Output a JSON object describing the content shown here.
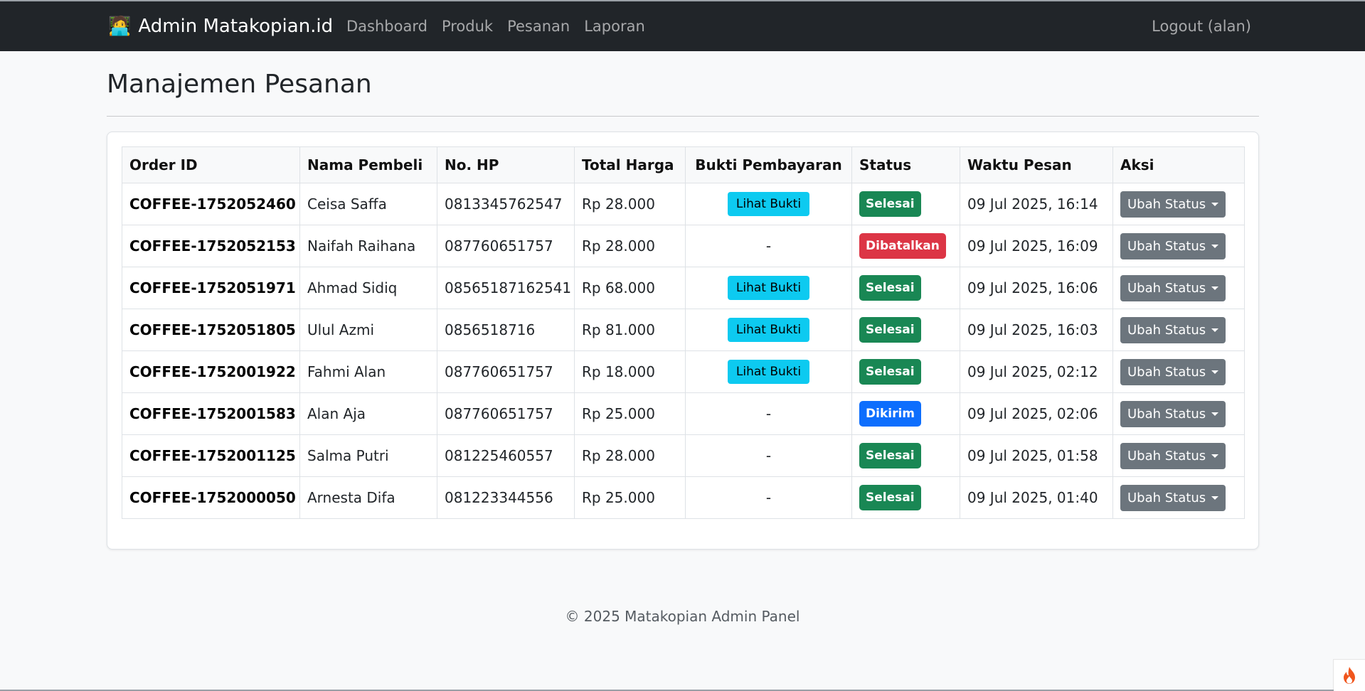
{
  "navbar": {
    "brand_icon": "🧑‍💻",
    "brand_text": "Admin Matakopian.id",
    "links": [
      "Dashboard",
      "Produk",
      "Pesanan",
      "Laporan"
    ],
    "logout": "Logout (alan)"
  },
  "page": {
    "title": "Manajemen Pesanan"
  },
  "table": {
    "headers": [
      "Order ID",
      "Nama Pembeli",
      "No. HP",
      "Total Harga",
      "Bukti Pembayaran",
      "Status",
      "Waktu Pesan",
      "Aksi"
    ],
    "proof_button_label": "Lihat Bukti",
    "no_proof": "-",
    "action_label": "Ubah Status",
    "status_colors": {
      "Selesai": "#198754",
      "Dibatalkan": "#dc3545",
      "Dikirim": "#0d6efd"
    },
    "rows": [
      {
        "order_id": "COFFEE-1752052460",
        "buyer": "Ceisa Saffa",
        "phone": "0813345762547",
        "total": "Rp 28.000",
        "has_proof": true,
        "status": "Selesai",
        "time": "09 Jul 2025, 16:14"
      },
      {
        "order_id": "COFFEE-1752052153",
        "buyer": "Naifah Raihana",
        "phone": "087760651757",
        "total": "Rp 28.000",
        "has_proof": false,
        "status": "Dibatalkan",
        "time": "09 Jul 2025, 16:09"
      },
      {
        "order_id": "COFFEE-1752051971",
        "buyer": "Ahmad Sidiq",
        "phone": "08565187162541",
        "total": "Rp 68.000",
        "has_proof": true,
        "status": "Selesai",
        "time": "09 Jul 2025, 16:06"
      },
      {
        "order_id": "COFFEE-1752051805",
        "buyer": "Ulul Azmi",
        "phone": "0856518716",
        "total": "Rp 81.000",
        "has_proof": true,
        "status": "Selesai",
        "time": "09 Jul 2025, 16:03"
      },
      {
        "order_id": "COFFEE-1752001922",
        "buyer": "Fahmi Alan",
        "phone": "087760651757",
        "total": "Rp 18.000",
        "has_proof": true,
        "status": "Selesai",
        "time": "09 Jul 2025, 02:12"
      },
      {
        "order_id": "COFFEE-1752001583",
        "buyer": "Alan Aja",
        "phone": "087760651757",
        "total": "Rp 25.000",
        "has_proof": false,
        "status": "Dikirim",
        "time": "09 Jul 2025, 02:06"
      },
      {
        "order_id": "COFFEE-1752001125",
        "buyer": "Salma Putri",
        "phone": "081225460557",
        "total": "Rp 28.000",
        "has_proof": false,
        "status": "Selesai",
        "time": "09 Jul 2025, 01:58"
      },
      {
        "order_id": "COFFEE-1752000050",
        "buyer": "Arnesta Difa",
        "phone": "081223344556",
        "total": "Rp 25.000",
        "has_proof": false,
        "status": "Selesai",
        "time": "09 Jul 2025, 01:40"
      }
    ]
  },
  "footer": {
    "text": "© 2025 Matakopian Admin Panel"
  },
  "corner_widget": {
    "icon": "flame-icon"
  }
}
